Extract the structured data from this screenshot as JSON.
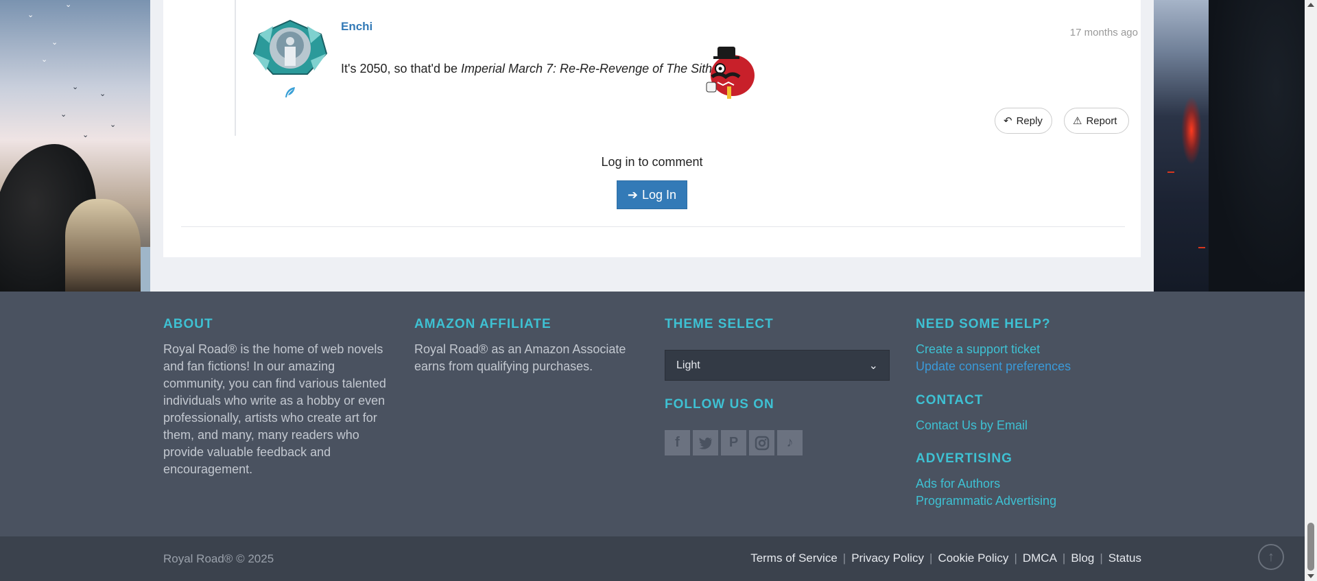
{
  "comment": {
    "author": "Enchi",
    "time": "17 months ago",
    "text_before": "It's 2050, so that'd be ",
    "text_italic": "Imperial March 7: Re-Re-Revenge of The Sith",
    "text_after": ".",
    "reply_label": "Reply",
    "report_label": "Report"
  },
  "login": {
    "prompt": "Log in to comment",
    "button_label": "Log In"
  },
  "footer": {
    "about": {
      "heading": "ABOUT",
      "text": "Royal Road® is the home of web novels and fan fictions! In our amazing community, you can find various talented individuals who write as a hobby or even professionally, artists who create art for them, and many, many readers who provide valuable feedback and encouragement."
    },
    "amazon": {
      "heading": "AMAZON AFFILIATE",
      "text": "Royal Road® as an Amazon Associate earns from qualifying purchases."
    },
    "theme": {
      "heading": "THEME SELECT",
      "selected": "Light",
      "follow_heading": "FOLLOW US ON",
      "social": [
        "facebook-icon",
        "twitter-icon",
        "pinterest-icon",
        "instagram-icon",
        "tiktok-icon"
      ]
    },
    "help": {
      "heading": "NEED SOME HELP?",
      "links": [
        "Create a support ticket",
        "Update consent preferences"
      ],
      "contact_heading": "CONTACT",
      "contact_link": "Contact Us by Email",
      "advertising_heading": "ADVERTISING",
      "advertising_links": [
        "Ads for Authors",
        "Programmatic Advertising"
      ]
    }
  },
  "bottom": {
    "copyright": "Royal Road® © 2025",
    "links": [
      "Terms of Service",
      "Privacy Policy",
      "Cookie Policy",
      "DMCA",
      "Blog",
      "Status"
    ]
  },
  "colors": {
    "accent": "#3ec1d3",
    "link_blue": "#337ab7",
    "footer_bg": "#4a5260",
    "bottom_bg": "#3b424d"
  }
}
